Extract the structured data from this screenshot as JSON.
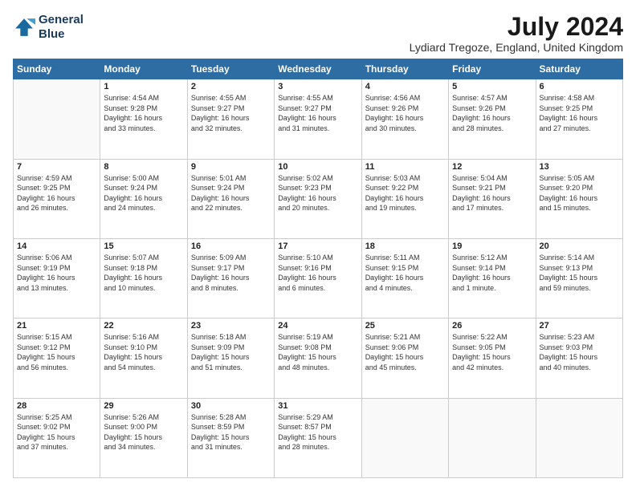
{
  "logo": {
    "line1": "General",
    "line2": "Blue"
  },
  "title": "July 2024",
  "location": "Lydiard Tregoze, England, United Kingdom",
  "days_of_week": [
    "Sunday",
    "Monday",
    "Tuesday",
    "Wednesday",
    "Thursday",
    "Friday",
    "Saturday"
  ],
  "weeks": [
    [
      {
        "day": "",
        "info": ""
      },
      {
        "day": "1",
        "info": "Sunrise: 4:54 AM\nSunset: 9:28 PM\nDaylight: 16 hours\nand 33 minutes."
      },
      {
        "day": "2",
        "info": "Sunrise: 4:55 AM\nSunset: 9:27 PM\nDaylight: 16 hours\nand 32 minutes."
      },
      {
        "day": "3",
        "info": "Sunrise: 4:55 AM\nSunset: 9:27 PM\nDaylight: 16 hours\nand 31 minutes."
      },
      {
        "day": "4",
        "info": "Sunrise: 4:56 AM\nSunset: 9:26 PM\nDaylight: 16 hours\nand 30 minutes."
      },
      {
        "day": "5",
        "info": "Sunrise: 4:57 AM\nSunset: 9:26 PM\nDaylight: 16 hours\nand 28 minutes."
      },
      {
        "day": "6",
        "info": "Sunrise: 4:58 AM\nSunset: 9:25 PM\nDaylight: 16 hours\nand 27 minutes."
      }
    ],
    [
      {
        "day": "7",
        "info": "Sunrise: 4:59 AM\nSunset: 9:25 PM\nDaylight: 16 hours\nand 26 minutes."
      },
      {
        "day": "8",
        "info": "Sunrise: 5:00 AM\nSunset: 9:24 PM\nDaylight: 16 hours\nand 24 minutes."
      },
      {
        "day": "9",
        "info": "Sunrise: 5:01 AM\nSunset: 9:24 PM\nDaylight: 16 hours\nand 22 minutes."
      },
      {
        "day": "10",
        "info": "Sunrise: 5:02 AM\nSunset: 9:23 PM\nDaylight: 16 hours\nand 20 minutes."
      },
      {
        "day": "11",
        "info": "Sunrise: 5:03 AM\nSunset: 9:22 PM\nDaylight: 16 hours\nand 19 minutes."
      },
      {
        "day": "12",
        "info": "Sunrise: 5:04 AM\nSunset: 9:21 PM\nDaylight: 16 hours\nand 17 minutes."
      },
      {
        "day": "13",
        "info": "Sunrise: 5:05 AM\nSunset: 9:20 PM\nDaylight: 16 hours\nand 15 minutes."
      }
    ],
    [
      {
        "day": "14",
        "info": "Sunrise: 5:06 AM\nSunset: 9:19 PM\nDaylight: 16 hours\nand 13 minutes."
      },
      {
        "day": "15",
        "info": "Sunrise: 5:07 AM\nSunset: 9:18 PM\nDaylight: 16 hours\nand 10 minutes."
      },
      {
        "day": "16",
        "info": "Sunrise: 5:09 AM\nSunset: 9:17 PM\nDaylight: 16 hours\nand 8 minutes."
      },
      {
        "day": "17",
        "info": "Sunrise: 5:10 AM\nSunset: 9:16 PM\nDaylight: 16 hours\nand 6 minutes."
      },
      {
        "day": "18",
        "info": "Sunrise: 5:11 AM\nSunset: 9:15 PM\nDaylight: 16 hours\nand 4 minutes."
      },
      {
        "day": "19",
        "info": "Sunrise: 5:12 AM\nSunset: 9:14 PM\nDaylight: 16 hours\nand 1 minute."
      },
      {
        "day": "20",
        "info": "Sunrise: 5:14 AM\nSunset: 9:13 PM\nDaylight: 15 hours\nand 59 minutes."
      }
    ],
    [
      {
        "day": "21",
        "info": "Sunrise: 5:15 AM\nSunset: 9:12 PM\nDaylight: 15 hours\nand 56 minutes."
      },
      {
        "day": "22",
        "info": "Sunrise: 5:16 AM\nSunset: 9:10 PM\nDaylight: 15 hours\nand 54 minutes."
      },
      {
        "day": "23",
        "info": "Sunrise: 5:18 AM\nSunset: 9:09 PM\nDaylight: 15 hours\nand 51 minutes."
      },
      {
        "day": "24",
        "info": "Sunrise: 5:19 AM\nSunset: 9:08 PM\nDaylight: 15 hours\nand 48 minutes."
      },
      {
        "day": "25",
        "info": "Sunrise: 5:21 AM\nSunset: 9:06 PM\nDaylight: 15 hours\nand 45 minutes."
      },
      {
        "day": "26",
        "info": "Sunrise: 5:22 AM\nSunset: 9:05 PM\nDaylight: 15 hours\nand 42 minutes."
      },
      {
        "day": "27",
        "info": "Sunrise: 5:23 AM\nSunset: 9:03 PM\nDaylight: 15 hours\nand 40 minutes."
      }
    ],
    [
      {
        "day": "28",
        "info": "Sunrise: 5:25 AM\nSunset: 9:02 PM\nDaylight: 15 hours\nand 37 minutes."
      },
      {
        "day": "29",
        "info": "Sunrise: 5:26 AM\nSunset: 9:00 PM\nDaylight: 15 hours\nand 34 minutes."
      },
      {
        "day": "30",
        "info": "Sunrise: 5:28 AM\nSunset: 8:59 PM\nDaylight: 15 hours\nand 31 minutes."
      },
      {
        "day": "31",
        "info": "Sunrise: 5:29 AM\nSunset: 8:57 PM\nDaylight: 15 hours\nand 28 minutes."
      },
      {
        "day": "",
        "info": ""
      },
      {
        "day": "",
        "info": ""
      },
      {
        "day": "",
        "info": ""
      }
    ]
  ]
}
